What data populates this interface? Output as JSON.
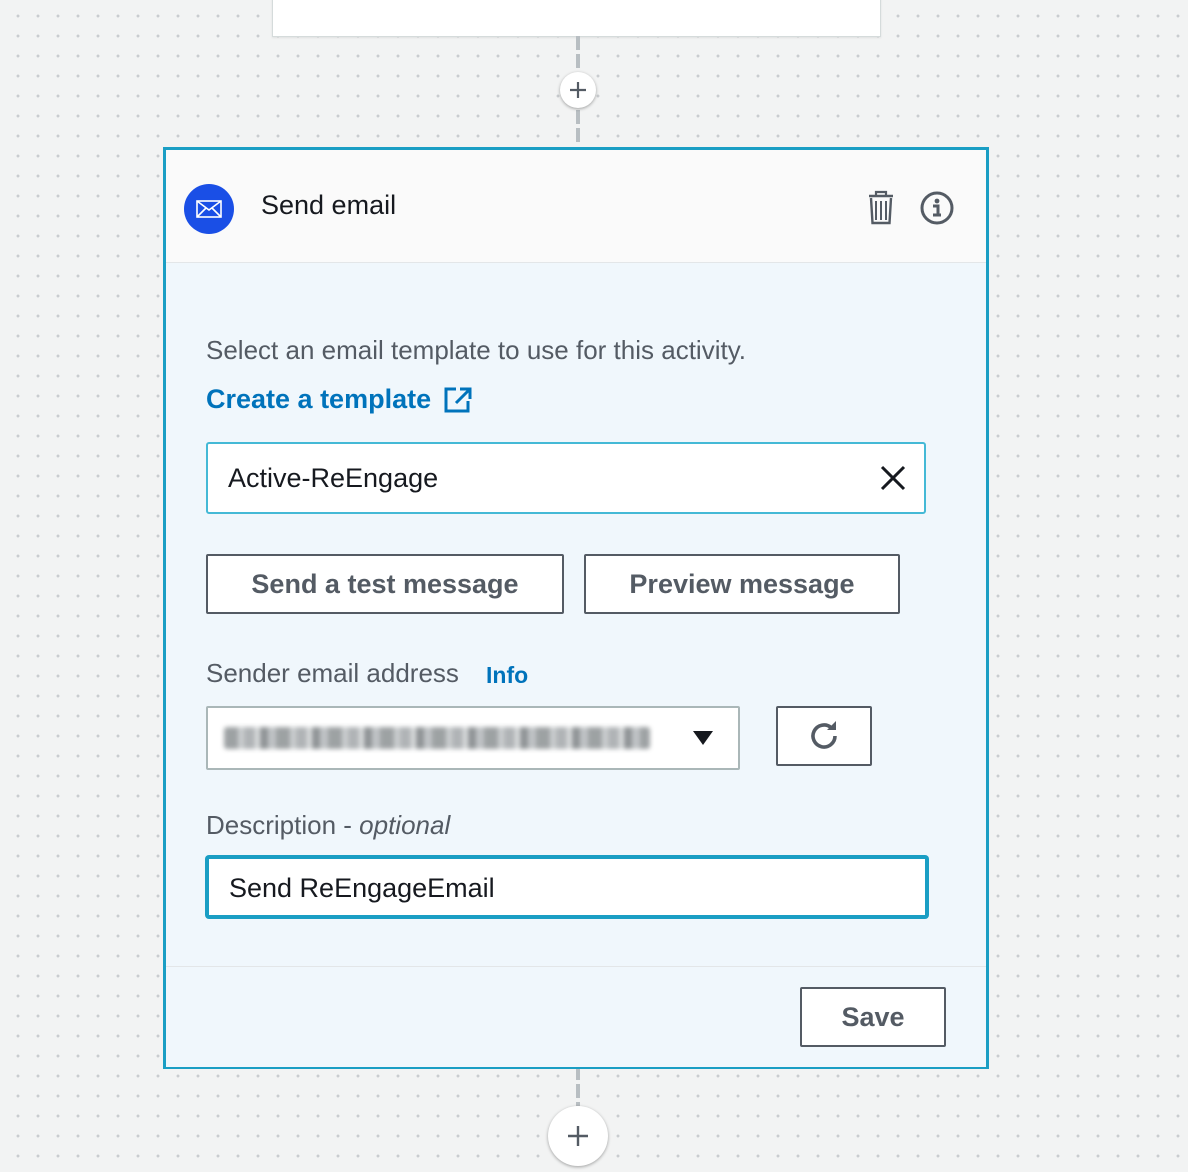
{
  "card": {
    "title": "Send email",
    "header_icons": {
      "badge": "envelope-icon",
      "delete": "trash-icon",
      "info": "info-circle-icon"
    }
  },
  "form": {
    "intro_text": "Select an email template to use for this activity.",
    "create_template_link": "Create a template",
    "template_value": "Active-ReEngage",
    "send_test_button": "Send a test message",
    "preview_button": "Preview message",
    "sender_label": "Sender email address",
    "sender_info_link": "Info",
    "description_label": "Description - ",
    "description_optional": "optional",
    "description_value": "Send ReEngageEmail"
  },
  "footer": {
    "save_button": "Save"
  },
  "colors": {
    "accent_border": "#1a9ec4",
    "link_blue": "#0073bb",
    "badge_blue": "#1a4fe6"
  }
}
